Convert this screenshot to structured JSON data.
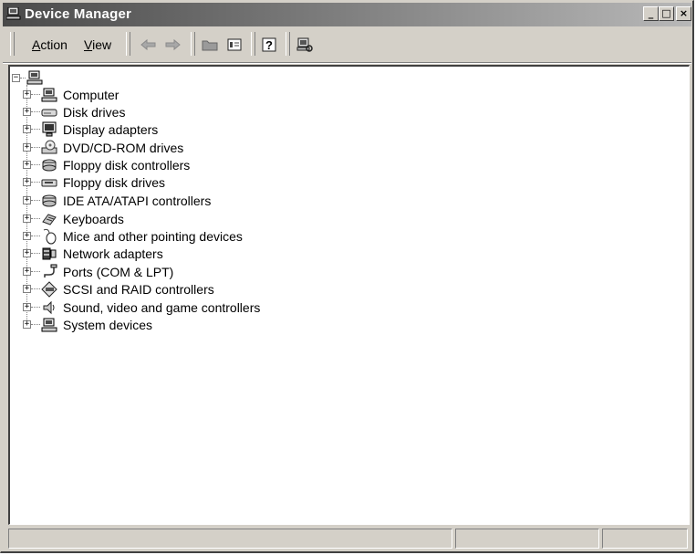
{
  "window": {
    "title": "Device Manager",
    "controls": [
      "minimize",
      "maximize",
      "close"
    ]
  },
  "menu": [
    {
      "label": "Action",
      "accel": "A"
    },
    {
      "label": "View",
      "accel": "V"
    }
  ],
  "toolbar_icons": [
    "back-arrow-icon",
    "forward-arrow-icon",
    "folder-icon",
    "properties-icon",
    "help-icon",
    "scan-hardware-icon"
  ],
  "tree": {
    "root_icon": "computer-icon",
    "items": [
      {
        "label": "Computer",
        "icon": "computer-icon"
      },
      {
        "label": "Disk drives",
        "icon": "disk-drive-icon"
      },
      {
        "label": "Display adapters",
        "icon": "monitor-icon"
      },
      {
        "label": "DVD/CD-ROM drives",
        "icon": "cdrom-icon"
      },
      {
        "label": "Floppy disk controllers",
        "icon": "controller-icon"
      },
      {
        "label": "Floppy disk drives",
        "icon": "floppy-drive-icon"
      },
      {
        "label": "IDE ATA/ATAPI controllers",
        "icon": "controller-icon"
      },
      {
        "label": "Keyboards",
        "icon": "keyboard-icon"
      },
      {
        "label": "Mice and other pointing devices",
        "icon": "mouse-icon"
      },
      {
        "label": "Network adapters",
        "icon": "network-icon"
      },
      {
        "label": "Ports (COM & LPT)",
        "icon": "port-icon"
      },
      {
        "label": "SCSI and RAID controllers",
        "icon": "scsi-icon"
      },
      {
        "label": "Sound, video and game controllers",
        "icon": "sound-icon"
      },
      {
        "label": "System devices",
        "icon": "computer-icon"
      }
    ]
  }
}
